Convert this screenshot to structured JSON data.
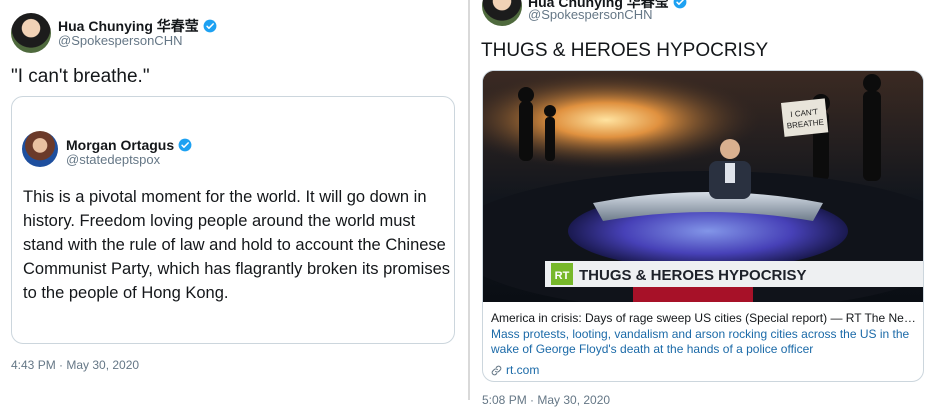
{
  "left_tweet": {
    "author_name": "Hua Chunying 华春莹",
    "author_handle": "@SpokespersonCHN",
    "text": "\"I can't breathe.\"",
    "quoted": {
      "author_name": "Morgan Ortagus",
      "author_handle": "@statedeptspox",
      "text": "This is a pivotal moment for the world. It will go down in history. Freedom loving people around the world must stand with the rule of law and hold to account the Chinese Communist Party, which has flagrantly broken its promises to the people of Hong Kong."
    },
    "timestamp": "4:43 PM · May 30, 2020"
  },
  "right_tweet": {
    "author_name": "Hua Chunying 华春莹",
    "author_handle": "@SpokespersonCHN",
    "text": "THUGS & HEROES HYPOCRISY",
    "card": {
      "lower_third_logo": "RT",
      "lower_third_title": "THUGS & HEROES HYPOCRISY",
      "sign_text": "I CAN'T BREATHE",
      "title": "America in crisis: Days of rage sweep US cities (Special report) — RT The News wi...",
      "description": "Mass protests, looting, vandalism and arson rocking cities across the US in the wake of George Floyd's death at the hands of a police officer",
      "domain": "rt.com"
    },
    "timestamp": "5:08 PM · May 30, 2020"
  },
  "colors": {
    "verified": "#1da1f2",
    "text": "#14171a",
    "secondary": "#657786",
    "link": "#1b6aa8",
    "border": "#ccd6dd",
    "rt_green": "#77b82a"
  },
  "icons": [
    "verified-badge-icon",
    "link-icon"
  ]
}
